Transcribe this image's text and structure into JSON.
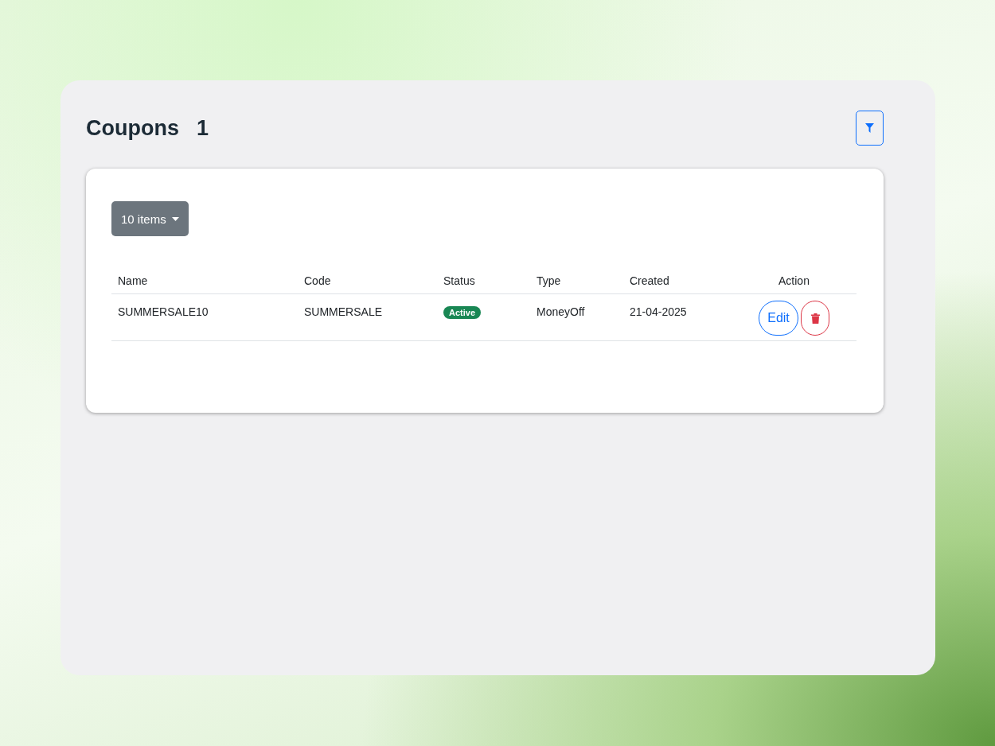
{
  "header": {
    "title": "Coupons",
    "count": "1"
  },
  "page_size": {
    "label": "10 items"
  },
  "table": {
    "columns": [
      "Name",
      "Code",
      "Status",
      "Type",
      "Created",
      "Action"
    ],
    "rows": [
      {
        "name": "SUMMERSALE10",
        "code": "SUMMERSALE",
        "status": "Active",
        "type": "MoneyOff",
        "created": "21-04-2025",
        "edit_label": "Edit"
      }
    ]
  }
}
